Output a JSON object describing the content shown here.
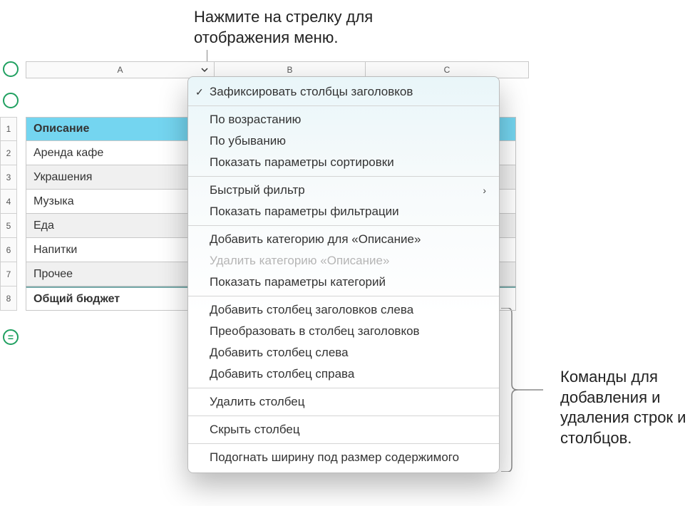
{
  "annotations": {
    "top": "Нажмите на стрелку для отображения меню.",
    "right": "Команды для добавления и удаления строк и столбцов."
  },
  "columns": [
    "A",
    "B",
    "C"
  ],
  "row_numbers": [
    "1",
    "2",
    "3",
    "4",
    "5",
    "6",
    "7",
    "8"
  ],
  "table": {
    "header": "Описание",
    "rows": [
      "Аренда кафе",
      "Украшения",
      "Музыка",
      "Еда",
      "Напитки",
      "Прочее"
    ],
    "total": "Общий бюджет"
  },
  "menu": {
    "freeze_header_columns": "Зафиксировать столбцы заголовков",
    "sort_asc": "По возрастанию",
    "sort_desc": "По убыванию",
    "show_sort_options": "Показать параметры сортировки",
    "quick_filter": "Быстрый фильтр",
    "show_filter_options": "Показать параметры фильтрации",
    "add_category_for": "Добавить категорию для «Описание»",
    "remove_category": "Удалить категорию «Описание»",
    "show_category_options": "Показать параметры категорий",
    "add_header_col_left": "Добавить столбец заголовков слева",
    "convert_to_header_col": "Преобразовать в столбец заголовков",
    "add_col_left": "Добавить столбец слева",
    "add_col_right": "Добавить столбец справа",
    "delete_col": "Удалить столбец",
    "hide_col": "Скрыть столбец",
    "fit_width": "Подогнать ширину под размер содержимого"
  },
  "icons": {
    "add_row": "="
  }
}
